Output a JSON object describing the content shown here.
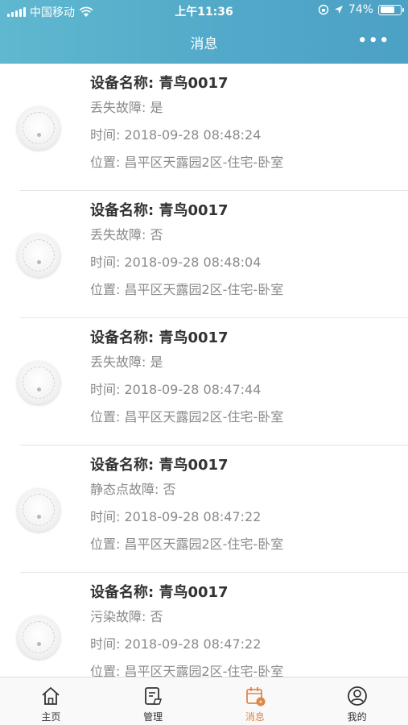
{
  "status_bar": {
    "carrier": "中国移动",
    "time": "上午11:36",
    "battery": "74%"
  },
  "nav": {
    "title": "消息",
    "more": "•••"
  },
  "messages": [
    {
      "title": "设备名称: 青鸟0017",
      "fault": "丢失故障: 是",
      "time": "时间: 2018-09-28 08:48:24",
      "location": "位置: 昌平区天露园2区-住宅-卧室"
    },
    {
      "title": "设备名称: 青鸟0017",
      "fault": "丢失故障: 否",
      "time": "时间: 2018-09-28 08:48:04",
      "location": "位置: 昌平区天露园2区-住宅-卧室"
    },
    {
      "title": "设备名称: 青鸟0017",
      "fault": "丢失故障: 是",
      "time": "时间: 2018-09-28 08:47:44",
      "location": "位置: 昌平区天露园2区-住宅-卧室"
    },
    {
      "title": "设备名称: 青鸟0017",
      "fault": "静态点故障: 否",
      "time": "时间: 2018-09-28 08:47:22",
      "location": "位置: 昌平区天露园2区-住宅-卧室"
    },
    {
      "title": "设备名称: 青鸟0017",
      "fault": "污染故障: 否",
      "time": "时间: 2018-09-28 08:47:22",
      "location": "位置: 昌平区天露园2区-住宅-卧室"
    }
  ],
  "tabs": [
    {
      "label": "主页",
      "icon": "home-icon"
    },
    {
      "label": "管理",
      "icon": "manage-icon"
    },
    {
      "label": "消息",
      "icon": "calendar-message-icon"
    },
    {
      "label": "我的",
      "icon": "user-icon"
    }
  ],
  "colors": {
    "header": "#52a9c9",
    "active_tab": "#e0874a"
  }
}
